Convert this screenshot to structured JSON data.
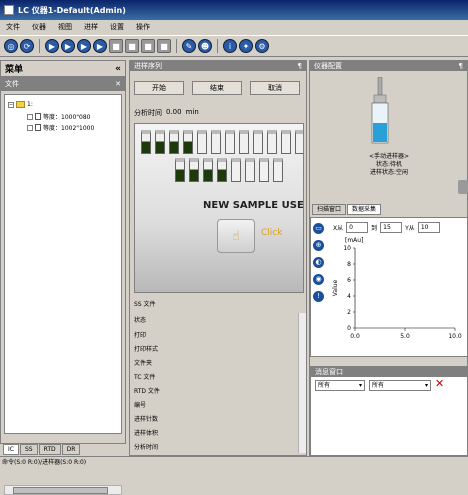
{
  "window": {
    "title": "LC 仪器1-Default(Admin)"
  },
  "menu": [
    "文件",
    "仪器",
    "视图",
    "进样",
    "设置",
    "操作"
  ],
  "left_panel": {
    "title": "菜单",
    "pin": "«",
    "subheader": "文件",
    "tree": {
      "root_label": "1:",
      "items": [
        "等度：1000\"080",
        "等度：1002\"1000"
      ]
    },
    "bottom_tabs": [
      "IC",
      "SS",
      "RTD",
      "DR"
    ]
  },
  "status_bar": "命令(S:0 R:0)/进样器(S:0 R:0)",
  "center_panel": {
    "header": "进样序列",
    "header_pin": "¶",
    "buttons": {
      "start": "开始",
      "end": "结束",
      "cancel": "取消"
    },
    "analysis_time_label": "分析时间",
    "analysis_time_value": "0.00",
    "analysis_time_unit": "min",
    "image_text": "NEW SAMPLE USE",
    "image_click": "Click",
    "list_header": "SS 文件",
    "list_items": [
      "状态",
      "打印",
      "打印样式",
      "文件夹",
      "TC 文件",
      "RTD 文件",
      "编号",
      "进样针数",
      "进样体积",
      "分析时间"
    ]
  },
  "right_panel": {
    "header": "仪器配置",
    "header_pin": "¶",
    "device_caption": [
      "<手动进样器>",
      "状态:待机",
      "进样状态:空闲"
    ],
    "tabs": [
      "扫描窗口",
      "数据采集"
    ],
    "x_from_label": "X从",
    "x_from": "0",
    "to_label": "到",
    "to": "15",
    "y_from_label": "Y从",
    "y_from": "10",
    "message_header": "消息窗口",
    "filter1": "所有",
    "filter2": "所有"
  },
  "chart_data": {
    "type": "line",
    "title": "",
    "xlabel": "",
    "ylabel": "Value",
    "y_unit": "[mAu]",
    "xlim": [
      0,
      10
    ],
    "ylim": [
      0,
      10
    ],
    "x_ticks": [
      "0.0",
      "5.0",
      "10.0"
    ],
    "y_ticks": [
      "0",
      "2",
      "4",
      "6",
      "8",
      "10"
    ],
    "series": []
  },
  "colors": {
    "titlebar": "#0a246a",
    "panel_header": "#808080",
    "toolbar_icon": "#2a5aa8",
    "vial_liquid": "#1f3a0a",
    "delete_icon": "#cc0000"
  },
  "icons": {
    "toolbar": [
      "scan-icon",
      "refresh-icon",
      "play-icon",
      "play-icon",
      "play-icon",
      "play-icon",
      "stop-icon",
      "stop-icon",
      "stop-icon",
      "stop-icon",
      "pen-icon",
      "person-icon",
      "info-icon",
      "settings-icon",
      "tools-icon"
    ]
  }
}
